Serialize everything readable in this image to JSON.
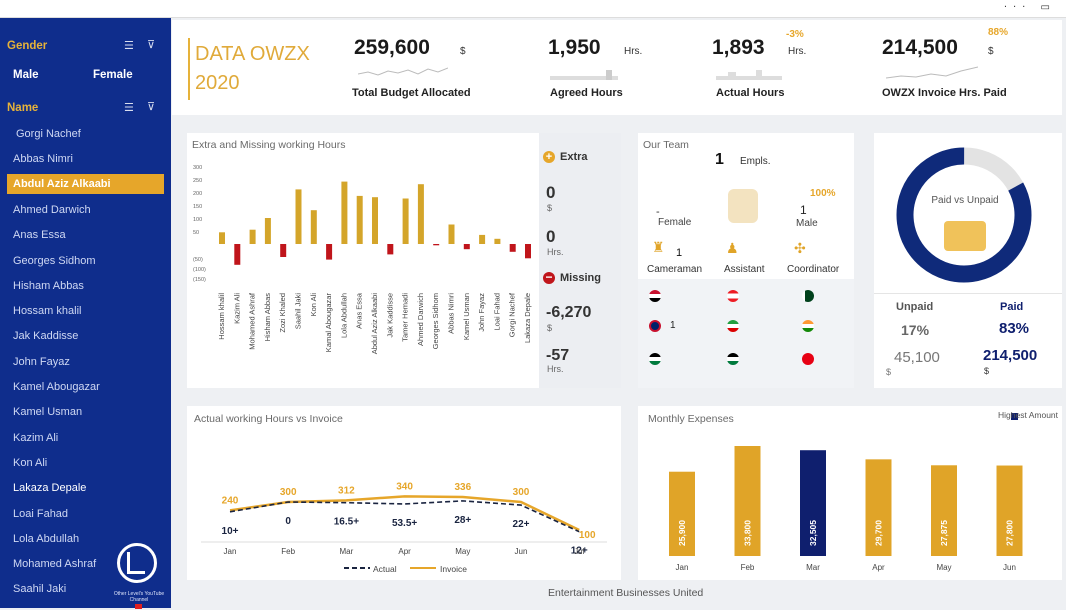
{
  "topbar": {
    "icons": "··· ▭"
  },
  "sidebar": {
    "gender_title": "Gender",
    "gender_options": [
      "Male",
      "Female"
    ],
    "name_title": "Name",
    "names": [
      "Gorgi Nachef",
      "Abbas Nimri",
      "Abdul Aziz Alkaabi",
      "Ahmed Darwich",
      "Anas Essa",
      "Georges Sidhom",
      "Hisham Abbas",
      "Hossam khalil",
      "Jak Kaddisse",
      "John Fayaz",
      "Kamel Abougazar",
      "Kamel Usman",
      "Kazim Ali",
      "Kon  Ali",
      "Lakaza Depale",
      "Loai Fahad",
      "Lola Abdullah",
      "Mohamed Ashraf",
      "Saahil Jaki"
    ],
    "selected_index": 2,
    "logo_text": "Other Level's YouTube Channel"
  },
  "header": {
    "title_line1": "DATA OWZX",
    "title_line2": "2020",
    "kpis": [
      {
        "value": "259,600",
        "unit": "$",
        "label": "Total Budget Allocated",
        "pct": ""
      },
      {
        "value": "1,950",
        "unit": "Hrs.",
        "label": "Agreed Hours",
        "pct": ""
      },
      {
        "value": "1,893",
        "unit": "Hrs.",
        "label": "Actual Hours",
        "pct": "-3%"
      },
      {
        "value": "214,500",
        "unit": "$",
        "label": "OWZX Invoice Hrs. Paid",
        "pct": "88%"
      }
    ]
  },
  "extra_missing": {
    "title": "Extra and Missing working Hours",
    "extra_label": "Extra",
    "extra_money": "0",
    "extra_money_unit": "$",
    "extra_hours": "0",
    "extra_hours_unit": "Hrs.",
    "missing_label": "Missing",
    "missing_money": "-6,270",
    "missing_money_unit": "$",
    "missing_hours": "-57",
    "missing_hours_unit": "Hrs."
  },
  "team": {
    "title": "Our Team",
    "count": "1",
    "count_label": "Empls.",
    "female_value": "-",
    "female_label": "Female",
    "male_pct": "100%",
    "male_value": "1",
    "male_label": "Male",
    "roles": [
      {
        "label": "Cameraman",
        "count": "1"
      },
      {
        "label": "Assistant",
        "count": ""
      },
      {
        "label": "Coordinator",
        "count": ""
      }
    ],
    "flag_count": "1"
  },
  "paid": {
    "center_label": "Paid vs Unpaid",
    "unpaid_label": "Unpaid",
    "paid_label": "Paid",
    "unpaid_pct": "17%",
    "paid_pct": "83%",
    "unpaid_value": "45,100",
    "paid_value": "214,500",
    "currency": "$",
    "paid_fraction": 0.83
  },
  "actual_vs_invoice": {
    "title": "Actual working Hours vs Invoice",
    "legend_actual": "Actual",
    "legend_invoice": "Invoice"
  },
  "monthly": {
    "title": "Monthly Expenses",
    "legend": "Highest Amount"
  },
  "footer": "Entertainment Businesses United",
  "chart_data": [
    {
      "type": "bar",
      "title": "Extra and Missing working Hours",
      "categories": [
        "Hossam khalil",
        "Kazim Ali",
        "Mohamed Ashraf",
        "Hisham Abbas",
        "Zozi Khaled",
        "Saahil Jaki",
        "Kon  Ali",
        "Kamal Abougazar",
        "Lola Abdullah",
        "Anas Essa",
        "Abdul Aziz Alkaabi",
        "Jak Kaddisse",
        "Tamer Hemadi",
        "Ahmed Darwich",
        "Georges Sidhom",
        "Abbas Nimri",
        "Kamel Usman",
        "John Fayaz",
        "Loai Fahad",
        "Gorgi Nachef",
        "Lakaza Depale"
      ],
      "values": [
        45,
        -80,
        55,
        100,
        -50,
        210,
        130,
        -60,
        240,
        185,
        180,
        -40,
        175,
        230,
        -5,
        75,
        -20,
        35,
        20,
        -30,
        -55
      ],
      "ytick_labels": [
        "300",
        "250",
        "200",
        "150",
        "100",
        "50",
        "(50)",
        "(100)",
        "(150)"
      ],
      "ylim": [
        -150,
        300
      ],
      "colors": {
        "positive": "#d4a52a",
        "negative": "#c0151b"
      }
    },
    {
      "type": "line",
      "title": "Actual working Hours vs Invoice",
      "categories": [
        "Jan",
        "Feb",
        "Mar",
        "Apr",
        "May",
        "Jun",
        "Jul"
      ],
      "series": [
        {
          "name": "Invoice",
          "values": [
            240,
            300,
            312,
            340,
            336,
            300,
            100
          ],
          "color": "#e6a62a"
        },
        {
          "name": "Actual",
          "values": [
            230,
            300,
            295,
            286,
            308,
            278,
            88
          ],
          "color": "#1a2440"
        }
      ],
      "labels": {
        "Invoice": [
          "240",
          "300",
          "312",
          "340",
          "336",
          "300",
          "100"
        ],
        "Actual": [
          "10+",
          "0",
          "16.5+",
          "53.5+",
          "28+",
          "22+",
          "12+"
        ]
      },
      "ylim": [
        0,
        400
      ]
    },
    {
      "type": "bar",
      "title": "Monthly Expenses",
      "categories": [
        "Jan",
        "Feb",
        "Mar",
        "Apr",
        "May",
        "Jun"
      ],
      "values": [
        25900,
        33800,
        32505,
        29700,
        27875,
        27800
      ],
      "labels": [
        "25,900",
        "33,800",
        "32,505",
        "29,700",
        "27,875",
        "27,800"
      ],
      "highest_index": 2,
      "colors": {
        "normal": "#e0a428",
        "highest": "#0f1f6e"
      },
      "legend": "Highest Amount"
    }
  ]
}
